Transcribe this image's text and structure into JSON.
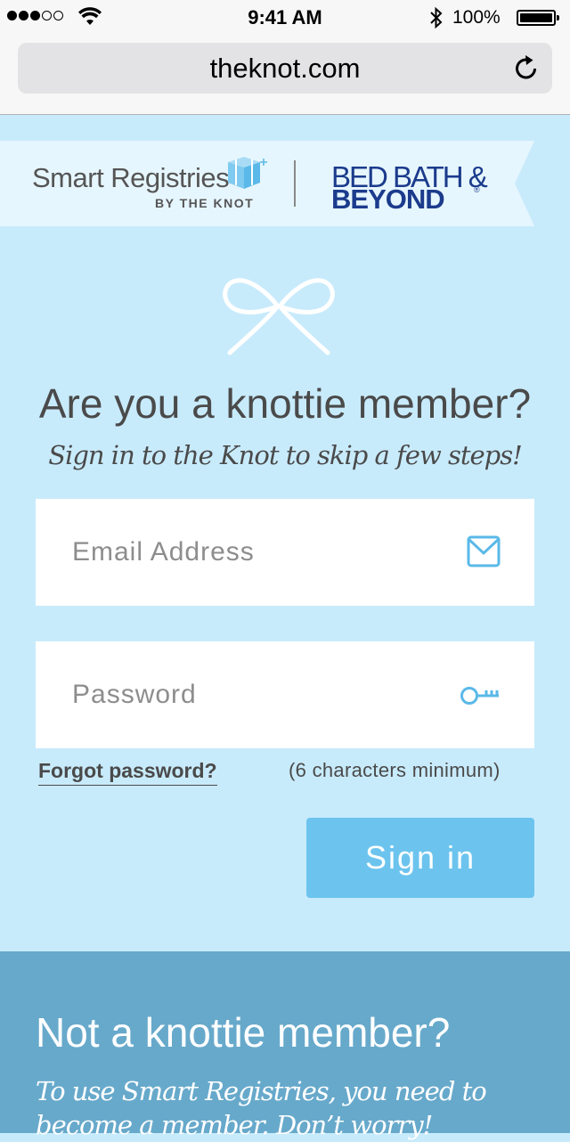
{
  "status_bar": {
    "time": "9:41 AM",
    "battery": "100%",
    "icons": [
      "signal-icon",
      "wifi-icon",
      "bluetooth-icon",
      "battery-icon"
    ]
  },
  "browser": {
    "url": "theknot.com",
    "reload_icon": "reload-icon"
  },
  "banner": {
    "brand_title": "Smart Registries",
    "brand_subtitle": "BY THE KNOT",
    "partner_line1": "BED BATH &",
    "partner_line2": "BEYOND",
    "partner_reg": "®"
  },
  "login": {
    "headline": "Are you a knottie member?",
    "subheadline": "Sign in to the Knot to skip a few steps!",
    "email_placeholder": "Email Address",
    "email_value": "",
    "password_placeholder": "Password",
    "password_value": "",
    "forgot_label": "Forgot password?",
    "password_hint": "(6 characters minimum)",
    "sign_in_label": "Sign in"
  },
  "signup": {
    "title": "Not a knottie member?",
    "text": "To use Smart Registries, you need to become a member. Don’t worry!"
  },
  "colors": {
    "page_bg": "#c8ebfc",
    "button_bg": "#6cc4ee",
    "bottom_bg": "#67a9cb",
    "partner_blue": "#1b3b8c",
    "icon_blue": "#5ab9e8"
  }
}
